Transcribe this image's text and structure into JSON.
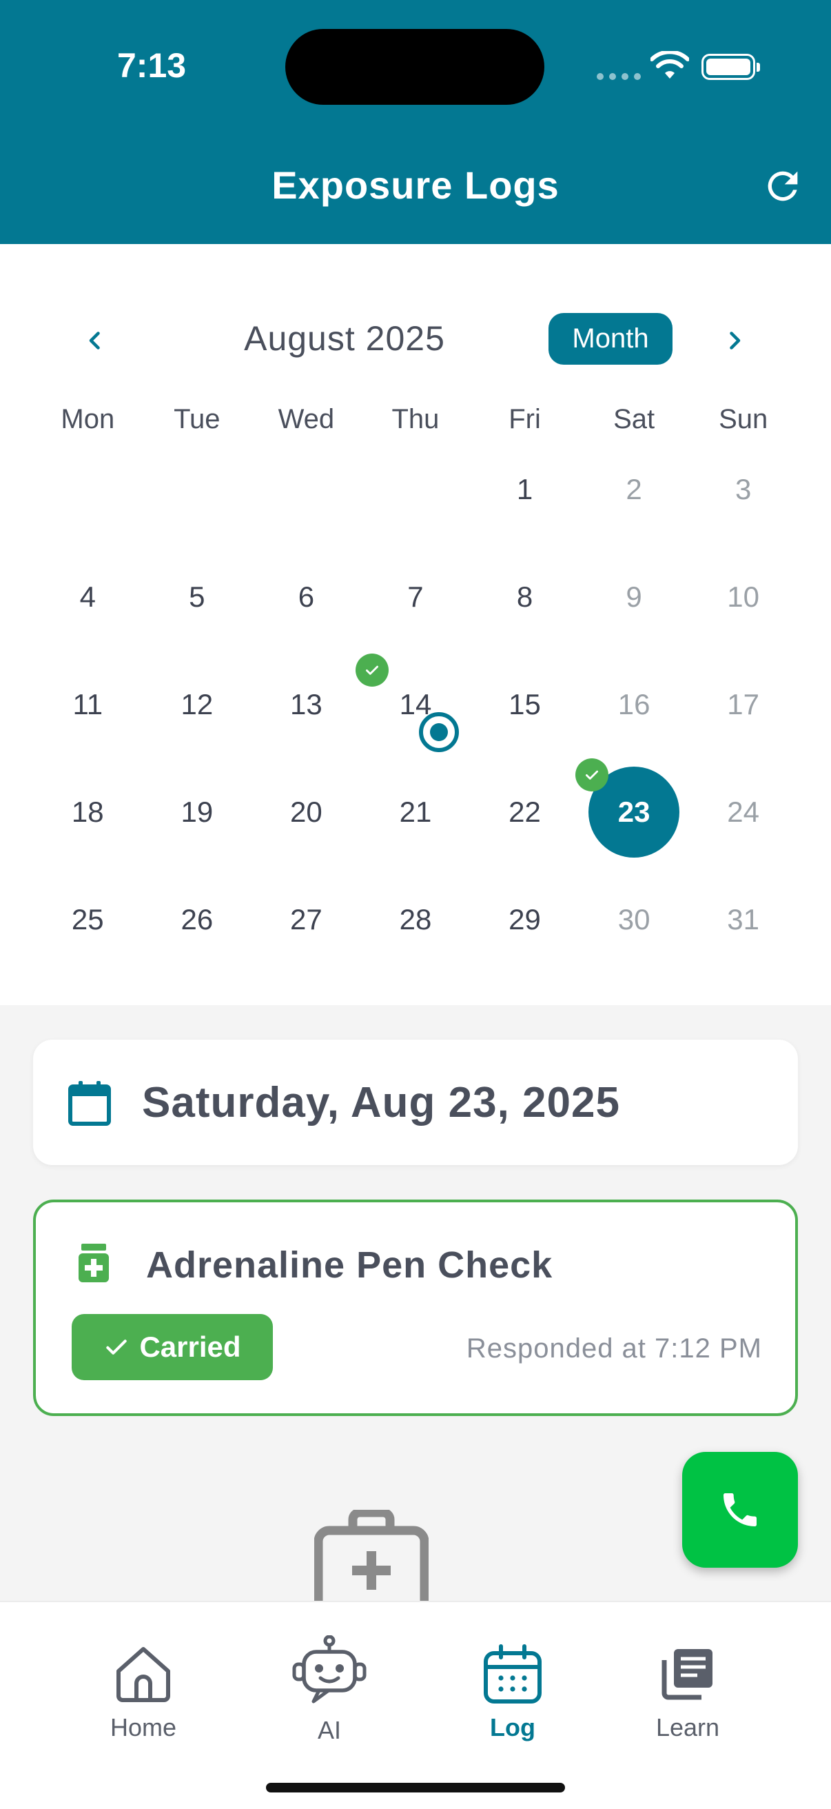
{
  "status_bar": {
    "time": "7:13"
  },
  "header": {
    "title": "Exposure Logs"
  },
  "calendar": {
    "month_label": "August 2025",
    "view_button": "Month",
    "weekdays": [
      "Mon",
      "Tue",
      "Wed",
      "Thu",
      "Fri",
      "Sat",
      "Sun"
    ],
    "weeks": [
      [
        "",
        "",
        "",
        "",
        "1",
        "2",
        "3"
      ],
      [
        "4",
        "5",
        "6",
        "7",
        "8",
        "9",
        "10"
      ],
      [
        "11",
        "12",
        "13",
        "14",
        "15",
        "16",
        "17"
      ],
      [
        "18",
        "19",
        "20",
        "21",
        "22",
        "23",
        "24"
      ],
      [
        "25",
        "26",
        "27",
        "28",
        "29",
        "30",
        "31"
      ]
    ],
    "selected_day": "23",
    "logged_days": [
      "14",
      "23"
    ],
    "today_marker_day": "14"
  },
  "selected_date": {
    "label": "Saturday, Aug 23, 2025"
  },
  "check_card": {
    "title": "Adrenaline Pen Check",
    "status": "Carried",
    "responded": "Responded at 7:12 PM"
  },
  "tabs": [
    {
      "label": "Home",
      "icon": "home-icon",
      "active": false
    },
    {
      "label": "AI",
      "icon": "robot-icon",
      "active": false
    },
    {
      "label": "Log",
      "icon": "calendar-icon",
      "active": true
    },
    {
      "label": "Learn",
      "icon": "library-icon",
      "active": false
    }
  ],
  "colors": {
    "primary": "#037892",
    "success": "#4caf50",
    "call": "#00c244"
  }
}
